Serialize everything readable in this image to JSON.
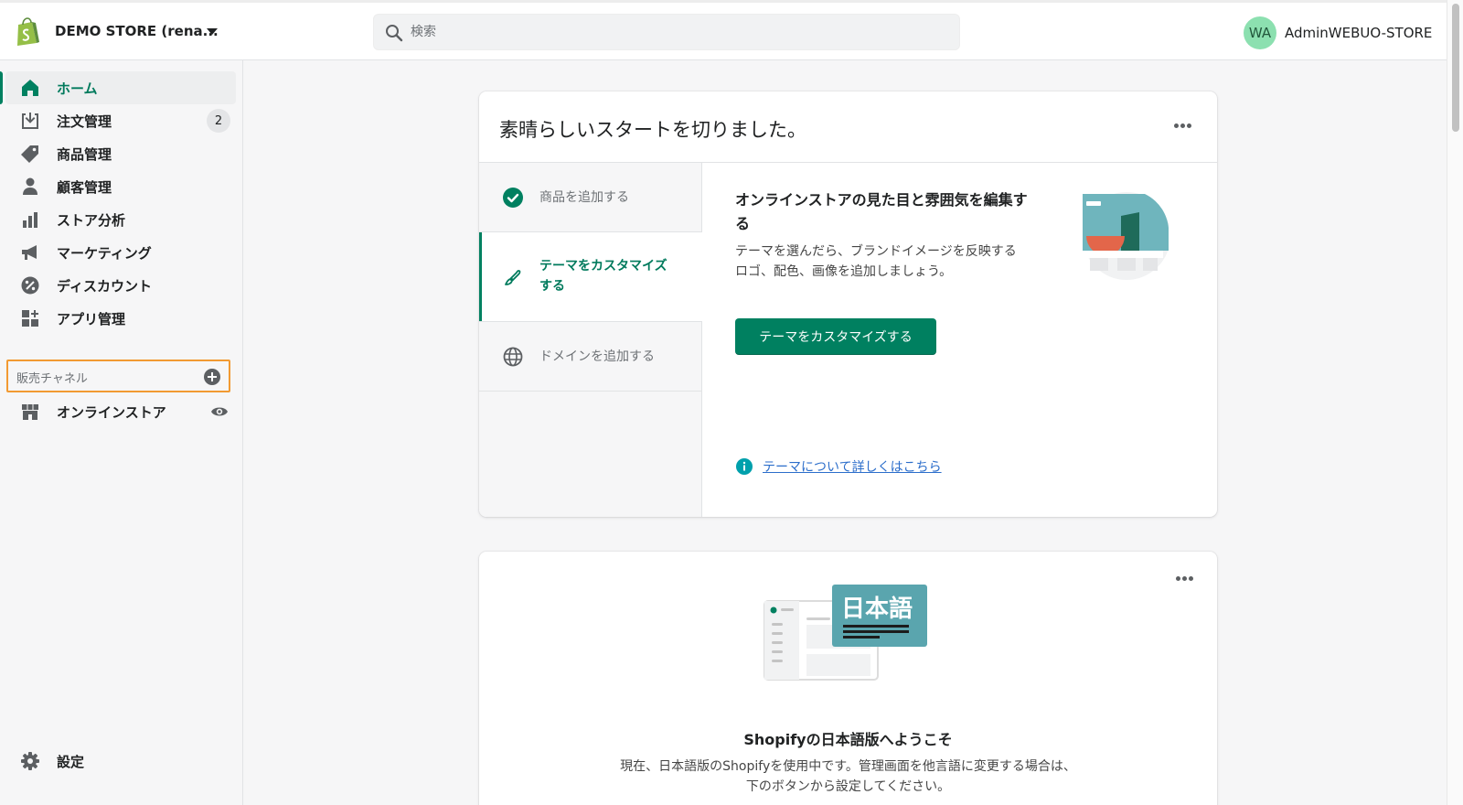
{
  "header": {
    "store_name": "DEMO STORE (rena...",
    "search_placeholder": "検索",
    "avatar_initials": "WA",
    "user_name": "AdminWEBUO-STORE"
  },
  "sidebar": {
    "items": [
      {
        "label": "ホーム",
        "icon": "home-icon",
        "active": true
      },
      {
        "label": "注文管理",
        "icon": "orders-icon",
        "badge": "2"
      },
      {
        "label": "商品管理",
        "icon": "tag-icon"
      },
      {
        "label": "顧客管理",
        "icon": "customer-icon"
      },
      {
        "label": "ストア分析",
        "icon": "analytics-icon"
      },
      {
        "label": "マーケティング",
        "icon": "megaphone-icon"
      },
      {
        "label": "ディスカウント",
        "icon": "discount-icon"
      },
      {
        "label": "アプリ管理",
        "icon": "apps-icon"
      }
    ],
    "channels_label": "販売チャネル",
    "online_store_label": "オンラインストア",
    "settings_label": "設定"
  },
  "setup_card": {
    "title": "素晴らしいスタートを切りました。",
    "steps": [
      {
        "label": "商品を追加する",
        "status": "done"
      },
      {
        "label": "テーマをカスタマイズする",
        "status": "active"
      },
      {
        "label": "ドメインを追加する",
        "status": "todo"
      }
    ],
    "detail_title": "オンラインストアの見た目と雰囲気を編集する",
    "detail_desc": "テーマを選んだら、ブランドイメージを反映するロゴ、配色、画像を追加しましょう。",
    "button_label": "テーマをカスタマイズする",
    "learn_more": "テーマについて詳しくはこちら"
  },
  "language_card": {
    "illustration_text": "日本語",
    "title": "Shopifyの日本語版へようこそ",
    "desc_line1": "現在、日本語版のShopifyを使用中です。管理画面を他言語に変更する場合は、",
    "desc_line2": "下のボタンから設定してください。"
  },
  "colors": {
    "accent": "#008060",
    "highlight": "#f29a32",
    "avatar_bg": "#8ce0b0"
  }
}
